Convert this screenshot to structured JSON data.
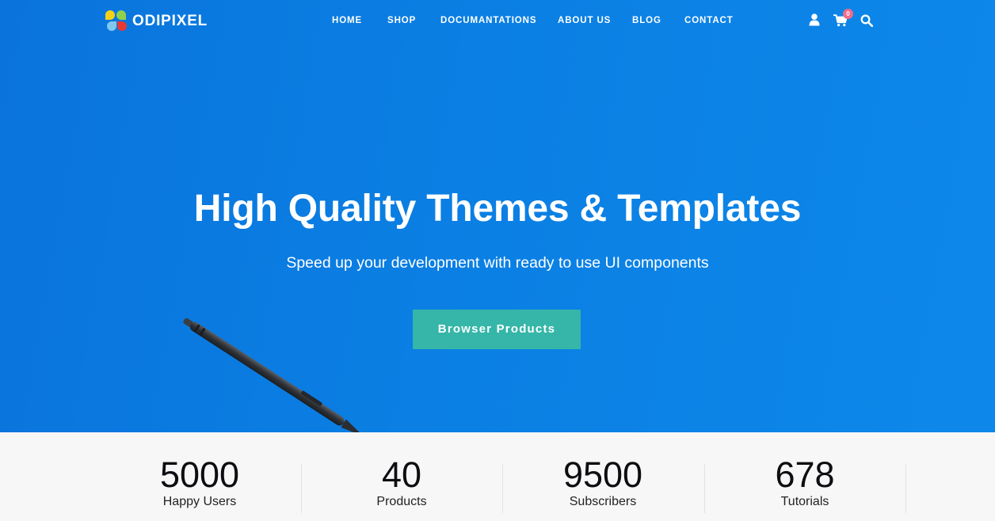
{
  "brand": {
    "name": "ODIPIXEL"
  },
  "nav": {
    "items": [
      "HOME",
      "SHOP",
      "DOCUMANTATIONS",
      "ABOUT US",
      "BLOG",
      "CONTACT"
    ]
  },
  "header_icons": {
    "user": "user-icon",
    "cart": "cart-icon",
    "cart_count": "0",
    "search": "search-icon"
  },
  "hero": {
    "title": "High Quality Themes & Templates",
    "subtitle": "Speed up your development with ready to use UI components",
    "cta_label": "Browser Products"
  },
  "stats": [
    {
      "value": "5000",
      "label": "Happy Users"
    },
    {
      "value": "40",
      "label": "Products"
    },
    {
      "value": "9500",
      "label": "Subscribers"
    },
    {
      "value": "678",
      "label": "Tutorials"
    }
  ],
  "colors": {
    "hero_bg": "#0b7fe3",
    "cta_bg": "#35b6a8",
    "badge": "#f06b8a",
    "stats_bg": "#f7f7f7"
  }
}
